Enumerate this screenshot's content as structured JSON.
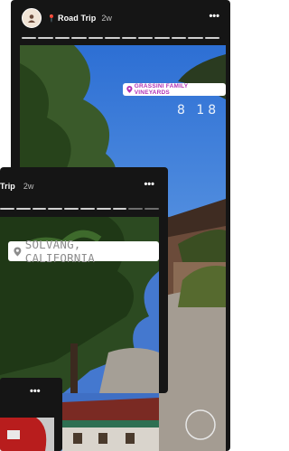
{
  "back_story": {
    "user_title": "Road Trip",
    "time": "2w",
    "sticker": "GRASSINI FAMILY VINEYARDS",
    "temperature": "8 18",
    "menu": "•••",
    "pin": "📍"
  },
  "front_story": {
    "user_title": "Trip",
    "time": "2w",
    "sticker": "SOLVANG, CALIFORNIA",
    "menu": "•••"
  },
  "third_story": {
    "menu": "•••"
  },
  "colors": {
    "card_bg": "#151515",
    "sky": "#3d7ad6",
    "tree": "#2f4f23",
    "sticker_text_purple": "#b132b6",
    "sticker_text_gray": "#8c8c8c"
  }
}
